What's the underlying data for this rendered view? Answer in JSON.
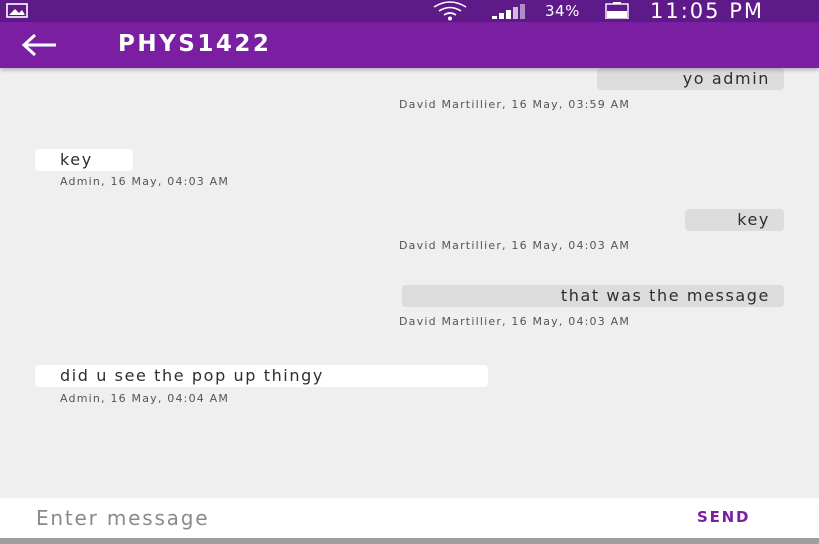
{
  "status_bar": {
    "battery_percent": "34%",
    "time": "11:05 PM"
  },
  "app_bar": {
    "title": "PHYS1422",
    "back_icon": "arrow-left-icon"
  },
  "messages": [
    {
      "sender": "me",
      "text": "yo admin",
      "meta": "David Martillier, 16 May, 03:59 AM"
    },
    {
      "sender": "other",
      "text": "key",
      "meta": "Admin, 16 May, 04:03 AM"
    },
    {
      "sender": "me",
      "text": "key",
      "meta": "David Martillier, 16 May, 04:03 AM"
    },
    {
      "sender": "me",
      "text": "that was the message",
      "meta": "David Martillier, 16 May, 04:03 AM"
    },
    {
      "sender": "other",
      "text": "did u see the pop up thingy",
      "meta": "Admin, 16 May, 04:04 AM"
    }
  ],
  "composer": {
    "placeholder": "Enter message",
    "send_label": "SEND"
  },
  "colors": {
    "status_bar": "#5f1a8a",
    "app_bar": "#7b1fa2",
    "background": "#efefef",
    "my_bubble": "#dcdcdc",
    "their_bubble": "#ffffff",
    "accent": "#7b1fa2"
  }
}
